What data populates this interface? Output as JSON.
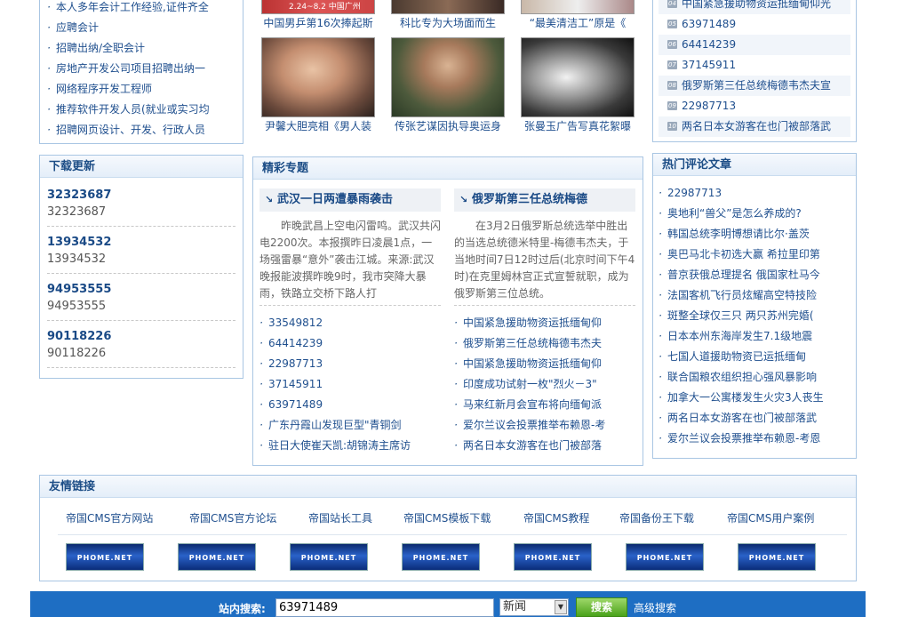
{
  "jobs": [
    "本人多年会计工作经验,证件齐全",
    "应聘会计",
    "招聘出纳/全职会计",
    "房地产开发公司项目招聘出纳一",
    "网络程序开发工程师",
    "推荐软件开发人员(就业或实习均",
    "招聘网页设计、开发、行政人员"
  ],
  "photos": [
    {
      "cap": "中国男乒第16次捧起斯",
      "overlay": "2.24~8.2 中国广州"
    },
    {
      "cap": "科比专为大场面而生"
    },
    {
      "cap": "“最美清洁工”原是《"
    },
    {
      "cap": "尹馨大胆亮相《男人装"
    },
    {
      "cap": "传张艺谋因执导奥运身"
    },
    {
      "cap": "张曼玉广告写真花絮曝"
    }
  ],
  "rank": [
    {
      "n": "04",
      "t": "中国紧急援助物资运抵缅甸仰光"
    },
    {
      "n": "05",
      "t": "63971489"
    },
    {
      "n": "06",
      "t": "64414239"
    },
    {
      "n": "07",
      "t": "37145911"
    },
    {
      "n": "08",
      "t": "俄罗斯第三任总统梅德韦杰夫宣"
    },
    {
      "n": "09",
      "t": "22987713"
    },
    {
      "n": "10",
      "t": "两名日本女游客在也门被部落武"
    }
  ],
  "download": {
    "title": "下载更新",
    "items": [
      {
        "name": "32323687",
        "desc": "32323687"
      },
      {
        "name": "13934532",
        "desc": "13934532"
      },
      {
        "name": "94953555",
        "desc": "94953555"
      },
      {
        "name": "90118226",
        "desc": "90118226"
      }
    ]
  },
  "featured": {
    "title": "精彩专题",
    "left": {
      "head": "武汉一日两遭暴雨袭击",
      "body": "昨晚武昌上空电闪雷鸣。武汉共闪电2200次。本报撰昨日凌晨1点，一场强雷暴“意外”袭击江城。来源:武汉晚报能波撰昨晚9时，我市突降大暴雨，铁路立交桥下路人打",
      "links": [
        "33549812",
        "64414239",
        "22987713",
        "37145911",
        "63971489",
        "广东丹霞山发现巨型\"青铜剑",
        "驻日大使崔天凯:胡锦涛主席访"
      ]
    },
    "right": {
      "head": "俄罗斯第三任总统梅德",
      "body": "在3月2日俄罗斯总统选举中胜出的当选总统德米特里-梅德韦杰夫，于当地时间7日12时过后(北京时间下午4时)在克里姆林宫正式宣誓就职，成为俄罗斯第三位总统。",
      "links": [
        "中国紧急援助物资运抵缅甸仰",
        "俄罗斯第三任总统梅德韦杰夫",
        "中国紧急援助物资运抵缅甸仰",
        "印度成功试射一枚\"烈火－3\"",
        "马来红新月会宣布将向缅甸派",
        "爱尔兰议会投票推举布赖恩-考",
        "两名日本女游客在也门被部落"
      ]
    }
  },
  "hot": {
    "title": "热门评论文章",
    "items": [
      "22987713",
      "奥地利“兽父”是怎么养成的?",
      "韩国总统李明博想请比尔·盖茨",
      "奥巴马北卡初选大赢 希拉里印第",
      "普京获俄总理提名 俄国家杜马今",
      "法国客机飞行员炫耀高空特技险",
      "斑整全球仅三只 两只苏州完婚(",
      "日本本州东海岸发生7.1级地震",
      "七国人道援助物资已运抵缅甸",
      "联合国粮农组织担心强风暴影响",
      "加拿大一公寓楼发生火灾3人丧生",
      "两名日本女游客在也门被部落武",
      "爱尔兰议会投票推举布赖恩-考恩"
    ]
  },
  "friends": {
    "title": "友情链接",
    "links": [
      "帝国CMS官方网站",
      "帝国CMS官方论坛",
      "帝国站长工具",
      "帝国CMS模板下载",
      "帝国CMS教程",
      "帝国备份王下载",
      "帝国CMS用户案例"
    ],
    "logo": "PHOME.NET"
  },
  "search": {
    "label": "站内搜索:",
    "value": "63971489",
    "select": "新闻",
    "button": "搜索",
    "advanced": "高级搜索"
  }
}
